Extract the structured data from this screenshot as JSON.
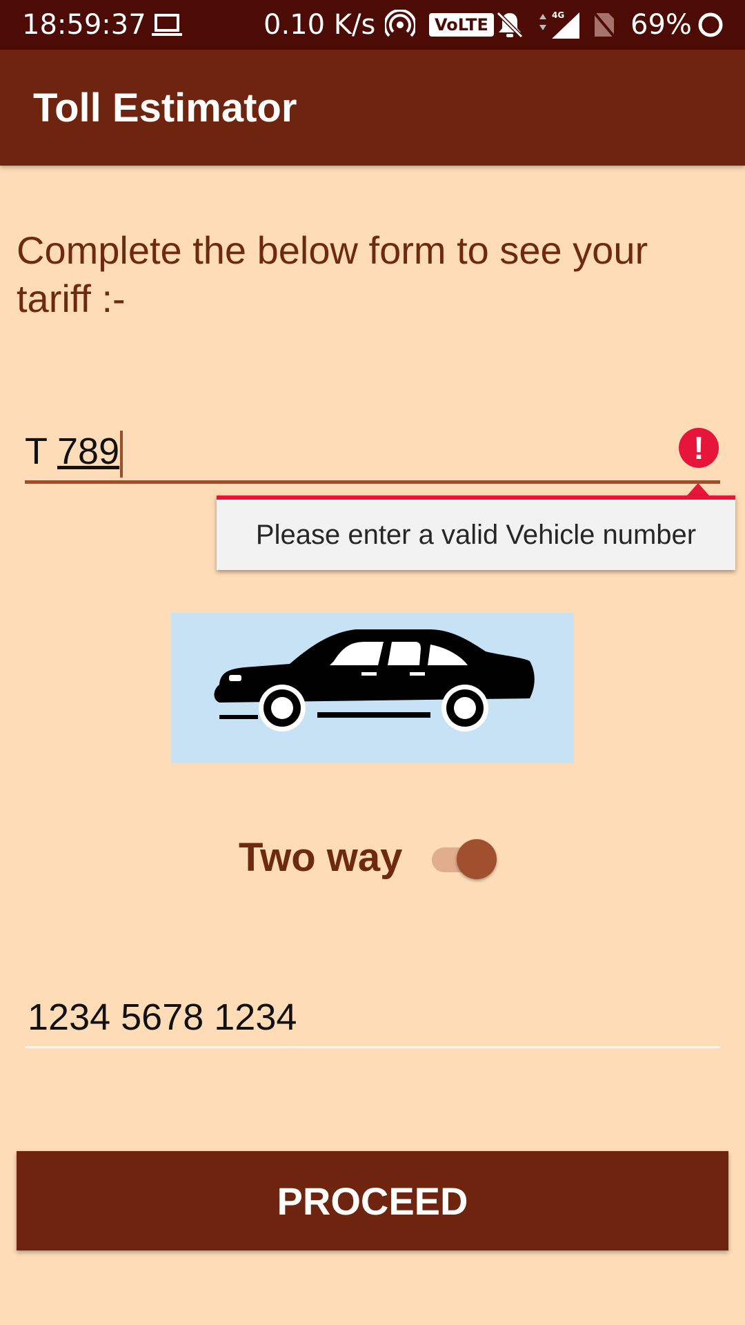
{
  "status_bar": {
    "time": "18:59:37",
    "network_speed": "0.10 K/s",
    "volte_label": "VoLTE",
    "network_type": "4G",
    "battery_percent": "69%"
  },
  "app_bar": {
    "title": "Toll Estimator"
  },
  "form": {
    "instruction": "Complete the below form to see your tariff :-",
    "vehicle_number": {
      "prefix": "T ",
      "underlined_part": "789"
    },
    "vehicle_error": "Please enter a valid Vehicle number",
    "two_way_label": "Two way",
    "two_way_enabled": true,
    "card_number": "1234 5678 1234",
    "proceed_label": "PROCEED"
  },
  "icons": {
    "vehicle_image": "car-icon",
    "error": "error-icon"
  },
  "colors": {
    "app_bar": "#6e240e",
    "background": "#fddcb7",
    "error": "#e8153b",
    "accent": "#a0502e"
  }
}
